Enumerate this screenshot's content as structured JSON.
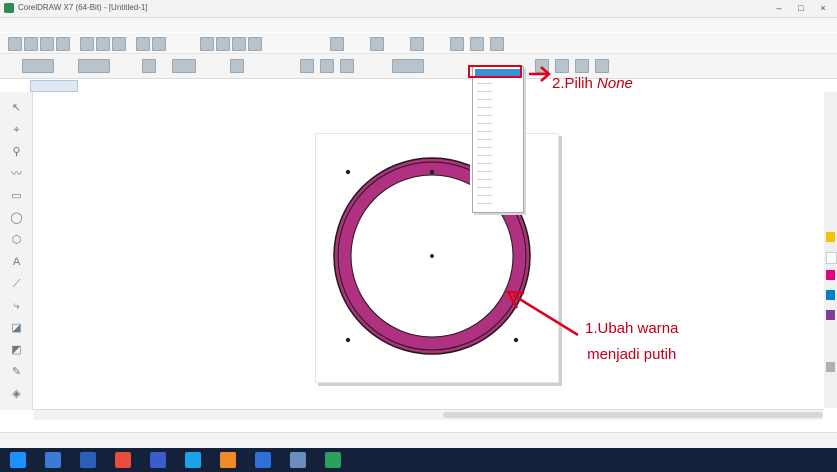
{
  "window": {
    "title": "CorelDRAW X7 (64-Bit) - [Untitled-1]"
  },
  "annotations": {
    "step2_prefix": "2.Pilih ",
    "step2_emphasis": "None",
    "step1_line1": "1.Ubah warna",
    "step1_line2": "menjadi putih"
  },
  "colors": {
    "ring_fill": "#b0317f",
    "ring_outline": "#1a1a1a",
    "annotation_red": "#e0001b",
    "dropdown_selected": "#3b8fd9"
  },
  "icons": [
    "app-icon",
    "minimize-icon",
    "maximize-icon",
    "close-icon",
    "pick-tool-icon",
    "shape-tool-icon",
    "zoom-tool-icon",
    "freehand-tool-icon",
    "rectangle-tool-icon",
    "ellipse-tool-icon",
    "polygon-tool-icon",
    "text-tool-icon",
    "fill-tool-icon",
    "eyedropper-tool-icon"
  ]
}
